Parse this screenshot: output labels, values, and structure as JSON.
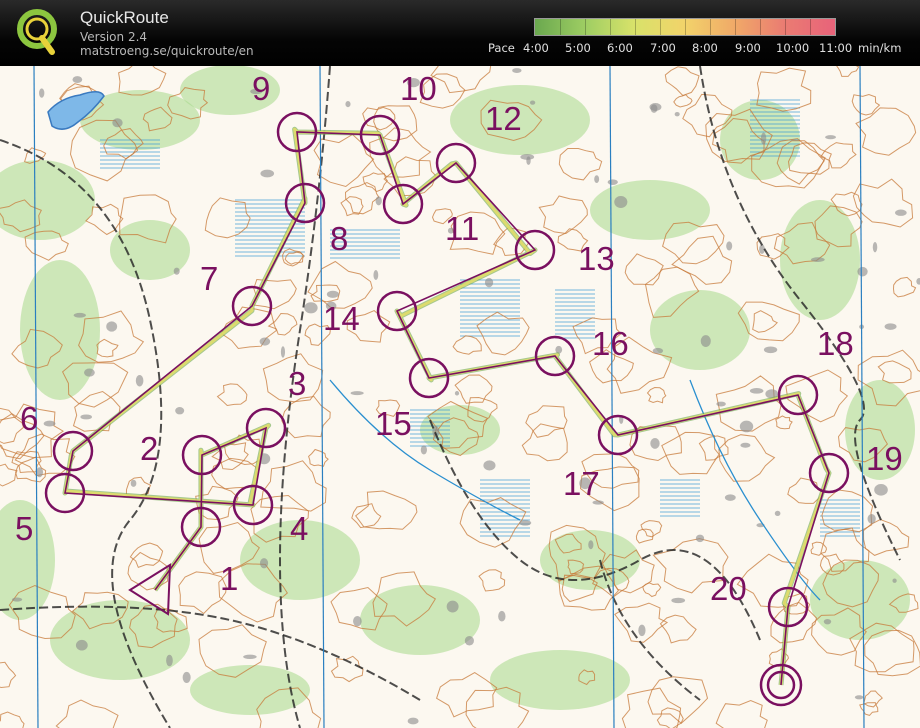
{
  "header": {
    "app_name": "QuickRoute",
    "version": "Version 2.4",
    "url": "matstroeng.se/quickroute/en",
    "logo_letter": "Q"
  },
  "pace_scale": {
    "label": "Pace",
    "ticks": [
      "4:00",
      "5:00",
      "6:00",
      "7:00",
      "8:00",
      "9:00",
      "10:00",
      "11:00"
    ],
    "unit": "min/km",
    "gradient_colors": [
      "#6aa84f",
      "#9fce63",
      "#d8e26a",
      "#f2d36a",
      "#f0a868",
      "#ea7c72",
      "#e8637a"
    ]
  },
  "map": {
    "colors": {
      "paper": "#fcf8f0",
      "contour": "#c77a3a",
      "vegetation": "#a6d98a",
      "water": "#2a8fcf",
      "marsh": "#3a9bd6",
      "course": "#7a1060",
      "route": "#e2dd6a",
      "rock": "#8a8a8a"
    },
    "course_controls": [
      {
        "label": "1"
      },
      {
        "label": "2"
      },
      {
        "label": "3"
      },
      {
        "label": "4"
      },
      {
        "label": "5"
      },
      {
        "label": "6"
      },
      {
        "label": "7"
      },
      {
        "label": "8"
      },
      {
        "label": "9"
      },
      {
        "label": "10"
      },
      {
        "label": "11"
      },
      {
        "label": "12"
      },
      {
        "label": "13"
      },
      {
        "label": "14"
      },
      {
        "label": "15"
      },
      {
        "label": "16"
      },
      {
        "label": "17"
      },
      {
        "label": "18"
      },
      {
        "label": "19"
      },
      {
        "label": "20"
      }
    ]
  }
}
